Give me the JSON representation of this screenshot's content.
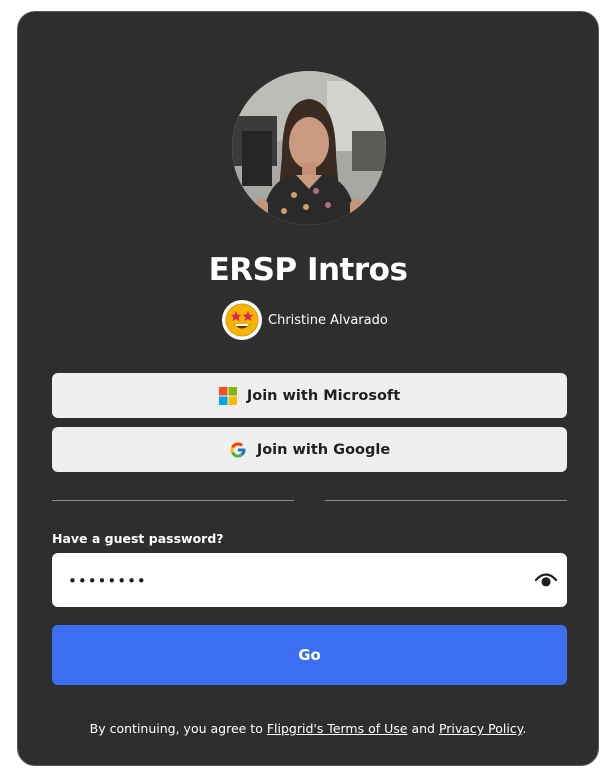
{
  "group": {
    "title": "ERSP Intros",
    "owner_name": "Christine Alvarado"
  },
  "auth": {
    "microsoft_label": "Join with Microsoft",
    "google_label": "Join with Google"
  },
  "guest": {
    "label": "Have a guest password?",
    "password_value": "••••••••"
  },
  "go_label": "Go",
  "legal": {
    "prefix": "By continuing, you agree to ",
    "terms_link": "Flipgrid's Terms of Use",
    "middle": " and ",
    "privacy_link": "Privacy Policy",
    "suffix": "."
  },
  "icons": {
    "microsoft": "microsoft-logo-icon",
    "google": "google-logo-icon",
    "eye": "eye-icon",
    "owner_emoji": "star-struck-emoji-icon"
  },
  "colors": {
    "card_bg": "#2e2e2e",
    "button_light": "#efefef",
    "go_button": "#3b6ef0"
  }
}
